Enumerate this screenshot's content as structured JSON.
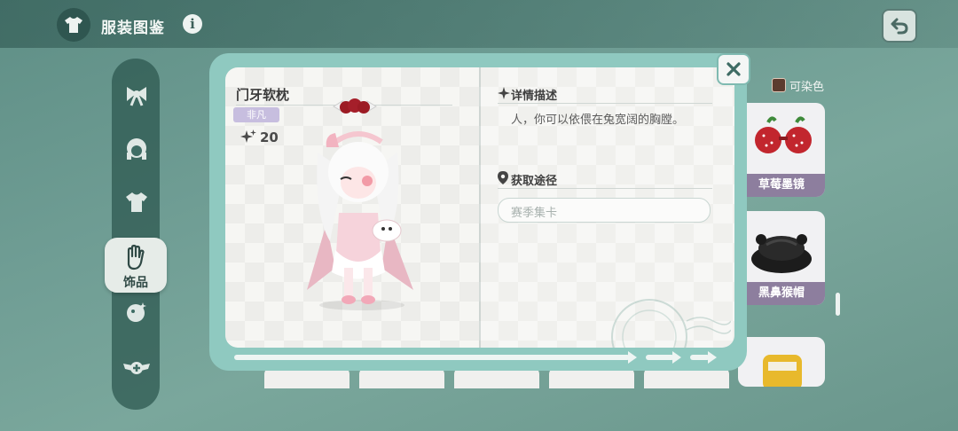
{
  "header": {
    "title": "服装图鉴",
    "info_glyph": "i",
    "back_icon": "return-arrow-icon",
    "title_icon": "shirt-icon"
  },
  "categories": [
    {
      "icon": "bow-icon",
      "label": ""
    },
    {
      "icon": "hair-icon",
      "label": ""
    },
    {
      "icon": "top-icon",
      "label": ""
    },
    {
      "icon": "hand-accessory-icon",
      "label": "饰品",
      "active": true
    },
    {
      "icon": "makeup-icon",
      "label": ""
    },
    {
      "icon": "wings-badge-icon",
      "label": ""
    }
  ],
  "filter": {
    "dye_label": "可染色",
    "dye_color": "#5b3b2e"
  },
  "side_items": [
    {
      "name": "草莓墨镜",
      "icon": "strawberry-sunglasses-icon"
    },
    {
      "name": "黑鼻猴帽",
      "icon": "black-monkey-hat-icon"
    },
    {
      "name": "",
      "icon": "yellow-item-icon"
    }
  ],
  "detail": {
    "item_name": "门牙软枕",
    "rarity": "非凡",
    "score": "20",
    "sections": {
      "description_title": "详情描述",
      "description_text": "人，你可以依偎在兔宽阔的胸膛。",
      "source_title": "获取途径",
      "source_value": "赛季集卡"
    },
    "close_icon": "close-icon"
  },
  "colors": {
    "accent_teal": "#8fc9c0",
    "rarity_purple": "#c7bedf",
    "card_name_bg": "#8d7e9e"
  }
}
